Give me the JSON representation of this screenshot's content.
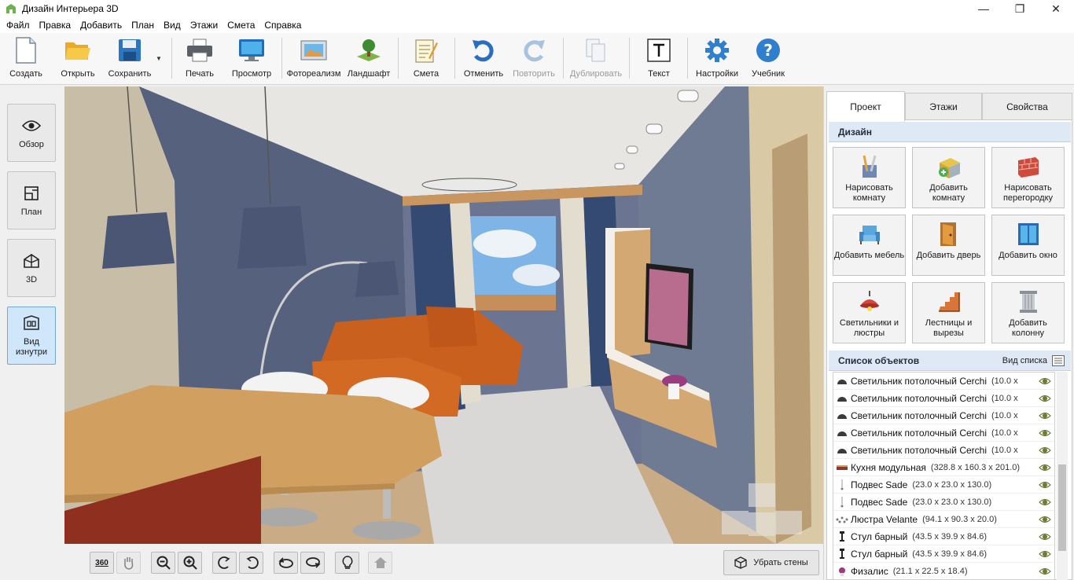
{
  "window": {
    "title": "Дизайн Интерьера 3D",
    "minimize": "—",
    "maximize": "❐",
    "close": "✕"
  },
  "menu": [
    "Файл",
    "Правка",
    "Добавить",
    "План",
    "Вид",
    "Этажи",
    "Смета",
    "Справка"
  ],
  "toolbar": {
    "create": "Создать",
    "open": "Открыть",
    "save": "Сохранить",
    "print": "Печать",
    "preview": "Просмотр",
    "photorealism": "Фотореализм",
    "landscape": "Ландшафт",
    "estimate": "Смета",
    "undo": "Отменить",
    "redo": "Повторить",
    "duplicate": "Дублировать",
    "text": "Текст",
    "settings": "Настройки",
    "tutorial": "Учебник"
  },
  "modes": {
    "overview": "Обзор",
    "plan": "План",
    "three_d": "3D",
    "inside_view": "Вид изнутри"
  },
  "bottom": {
    "rotate360": "360",
    "remove_walls": "Убрать стены"
  },
  "tabs": [
    "Проект",
    "Этажи",
    "Свойства"
  ],
  "design": {
    "header": "Дизайн",
    "buttons": [
      "Нарисовать комнату",
      "Добавить комнату",
      "Нарисовать перегородку",
      "Добавить мебель",
      "Добавить дверь",
      "Добавить окно",
      "Светильники и люстры",
      "Лестницы и вырезы",
      "Добавить колонну"
    ]
  },
  "objects": {
    "header": "Список объектов",
    "view_toggle": "Вид списка",
    "items": [
      {
        "name": "Светильник потолочный Cerchi",
        "size": "(10.0 x"
      },
      {
        "name": "Светильник потолочный Cerchi",
        "size": "(10.0 x"
      },
      {
        "name": "Светильник потолочный Cerchi",
        "size": "(10.0 x"
      },
      {
        "name": "Светильник потолочный Cerchi",
        "size": "(10.0 x"
      },
      {
        "name": "Светильник потолочный Cerchi",
        "size": "(10.0 x"
      },
      {
        "name": "Кухня модульная",
        "size": "(328.8 x 160.3 x 201.0)"
      },
      {
        "name": "Подвес Sade",
        "size": "(23.0 x 23.0 x 130.0)"
      },
      {
        "name": "Подвес Sade",
        "size": "(23.0 x 23.0 x 130.0)"
      },
      {
        "name": "Люстра Velante",
        "size": "(94.1 x 90.3 x 20.0)"
      },
      {
        "name": "Стул барный",
        "size": "(43.5 x 39.9 x 84.6)"
      },
      {
        "name": "Стул барный",
        "size": "(43.5 x 39.9 x 84.6)"
      },
      {
        "name": "Физалис",
        "size": "(21.1 x 22.5 x 18.4)"
      }
    ]
  },
  "colors": {
    "accent": "#cfe6fb",
    "section_header": "#dfe9f5",
    "wall_blue": "#5a6580",
    "sofa": "#c9601e"
  }
}
